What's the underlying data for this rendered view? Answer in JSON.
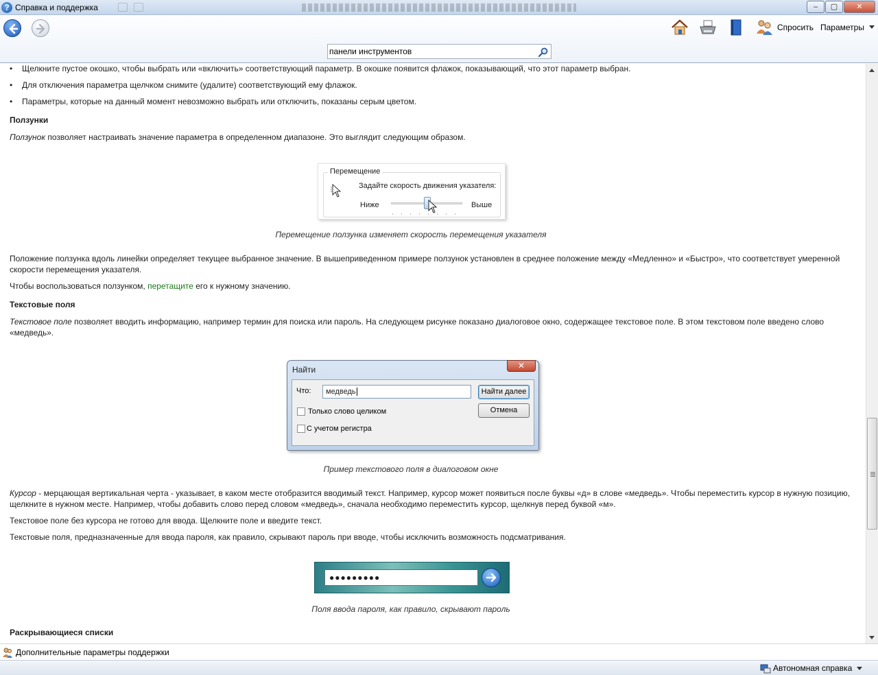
{
  "window": {
    "title": "Справка и поддержка",
    "minimize_glyph": "‒",
    "maximize_glyph": "▢",
    "close_glyph": "✕"
  },
  "toolbar": {
    "ask_label": "Спросить",
    "options_label": "Параметры",
    "icons": [
      "home-icon",
      "print-icon",
      "browse-help-icon",
      "ask-people-icon"
    ]
  },
  "search": {
    "value": "панели инструментов"
  },
  "content": {
    "bullets": [
      "Щелкните пустое окошко, чтобы выбрать или «включить» соответствующий параметр. В окошке появится флажок, показывающий, что этот параметр выбран.",
      "Для отключения параметра щелчком снимите (удалите) соответствующий ему флажок.",
      "Параметры, которые на данный момент невозможно выбрать или отключить, показаны серым цветом."
    ],
    "sliders_heading": "Ползунки",
    "sliders_term": "Ползунок",
    "sliders_intro": " позволяет настраивать значение параметра в определенном диапазоне. Это выглядит следующим образом.",
    "slider_figure": {
      "group_label": "Перемещение",
      "prompt": "Задайте скорость движения указателя:",
      "low": "Ниже",
      "high": "Выше",
      "position": 0.5
    },
    "slider_caption": "Перемещение ползунка изменяет скорость перемещения указателя",
    "slider_p1": "Положение ползунка вдоль линейки определяет текущее выбранное значение. В вышеприведенном примере ползунок установлен в среднее положение между «Медленно» и «Быстро», что соответствует умеренной скорости перемещения указателя.",
    "slider_p2_before": "Чтобы воспользоваться ползунком, ",
    "slider_p2_link": "перетащите",
    "slider_p2_after": " его к нужному значению.",
    "text_heading": "Текстовые поля",
    "text_term": "Текстовое поле",
    "text_intro": " позволяет вводить информацию, например термин для поиска или пароль. На следующем рисунке показано диалоговое окно, содержащее текстовое поле. В этом текстовом поле введено слово «медведь».",
    "find_figure": {
      "title": "Найти",
      "what_label": "Что:",
      "what_value": "медведь",
      "find_next": "Найти далее",
      "cancel": "Отмена",
      "whole_word": "Только слово целиком",
      "match_case": "С учетом регистра"
    },
    "find_caption": "Пример текстового поля в диалоговом окне",
    "cursor_term": "Курсор",
    "cursor_text": " - мерцающая вертикальная черта - указывает, в каком месте отобразится вводимый текст. Например, курсор может появиться после буквы «д» в слове «медведь». Чтобы переместить курсор в нужную позицию, щелкните в нужном месте. Например, чтобы добавить слово перед словом «медведь», сначала необходимо переместить курсор, щелкнув перед буквой «м».",
    "no_cursor_text": "Текстовое поле без курсора не готово для ввода. Щелкните поле и введите текст.",
    "password_text": "Текстовые поля, предназначенные для ввода пароля, как правило, скрывают пароль при вводе, чтобы исключить возможность подсматривания.",
    "password_value": "●●●●●●●●●",
    "password_caption": "Поля ввода пароля, как правило, скрывают пароль",
    "dropdown_heading": "Раскрывающиеся списки"
  },
  "footer": {
    "support_link": "Дополнительные параметры поддержки",
    "status_label": "Автономная справка"
  },
  "colors": {
    "link": "#1a7a1a",
    "titlebar": "#c4d6ec"
  }
}
